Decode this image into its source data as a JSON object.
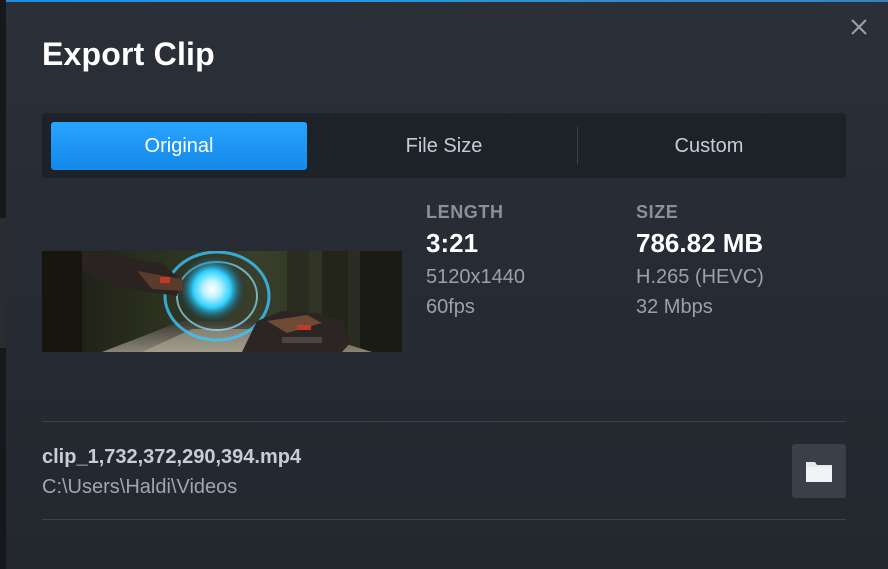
{
  "dialog": {
    "title": "Export Clip",
    "close_icon": "close-icon"
  },
  "tabs": [
    {
      "label": "Original",
      "active": true
    },
    {
      "label": "File Size",
      "active": false
    },
    {
      "label": "Custom",
      "active": false
    }
  ],
  "clip": {
    "length_label": "LENGTH",
    "length_value": "3:21",
    "resolution": "5120x1440",
    "framerate": "60fps",
    "size_label": "SIZE",
    "size_value": "786.82 MB",
    "codec": "H.265 (HEVC)",
    "bitrate": "32 Mbps"
  },
  "file": {
    "name": "clip_1,732,372,290,394.mp4",
    "path": "C:\\Users\\Haldi\\Videos",
    "folder_icon": "folder-icon"
  },
  "colors": {
    "accent": "#1a9fff",
    "dialog_bg": "#2b2f37",
    "tabbar_bg": "#1d2128"
  }
}
